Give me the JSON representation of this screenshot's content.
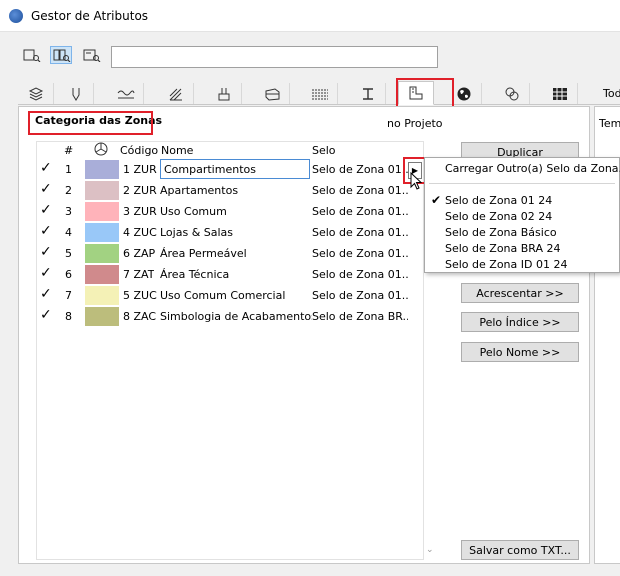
{
  "window": {
    "title": "Gestor de Atributos"
  },
  "toolbar": {
    "search_value": ""
  },
  "tabs": {
    "icons": [
      "layers-icon",
      "pen-icon",
      "line-type-icon",
      "fill-icon",
      "building-material-icon",
      "composite-icon",
      "profile-icon",
      "beam-icon",
      "zone-stamp-icon",
      "globe-icon",
      "mep-icon",
      "table-icon"
    ],
    "partial_label": "Tod"
  },
  "section": {
    "title": "Categoria das Zonas",
    "in_project": "no Projeto"
  },
  "table": {
    "headers": {
      "num": "#",
      "color": "",
      "code": "Código",
      "name": "Nome",
      "stamp": "Selo"
    },
    "rows": [
      {
        "num": "1",
        "color": "#a9aed9",
        "code": "1 ZUR",
        "name": "Compartimentos",
        "stamp": "Selo de Zona 01..."
      },
      {
        "num": "2",
        "color": "#dcc0c4",
        "code": "2 ZUR",
        "name": "Apartamentos",
        "stamp": "Selo de Zona 01..."
      },
      {
        "num": "3",
        "color": "#ffb3ba",
        "code": "3 ZUR",
        "name": "Uso Comum",
        "stamp": "Selo de Zona 01..."
      },
      {
        "num": "4",
        "color": "#99c8f8",
        "code": "4 ZUC",
        "name": "Lojas & Salas",
        "stamp": "Selo de Zona 01..."
      },
      {
        "num": "5",
        "color": "#a2d282",
        "code": "6 ZAP",
        "name": "Área Permeável",
        "stamp": "Selo de Zona 01..."
      },
      {
        "num": "6",
        "color": "#d08a8c",
        "code": "7 ZAT",
        "name": "Área Técnica",
        "stamp": "Selo de Zona 01..."
      },
      {
        "num": "7",
        "color": "#f4f1b6",
        "code": "5 ZUC",
        "name": "Uso Comum Comercial",
        "stamp": "Selo de Zona 01..."
      },
      {
        "num": "8",
        "color": "#bcbd7c",
        "code": "8 ZAC",
        "name": "Simbologia de Acabamentos",
        "stamp": "Selo de Zona BR..."
      }
    ]
  },
  "buttons": {
    "duplicate": "Duplicar",
    "append": "Acrescentar >>",
    "by_index": "Pelo Índice >>",
    "by_name": "Pelo Nome >>",
    "save_txt": "Salvar como TXT..."
  },
  "menu": {
    "load_other": "Carregar Outro(a) Selo da Zona...",
    "items": [
      "Selo de Zona 01 24",
      "Selo de Zona 02 24",
      "Selo de Zona Básico",
      "Selo de Zona BRA 24",
      "Selo de Zona ID 01 24"
    ],
    "checked_index": 0
  },
  "right_panel": {
    "partial_label": "Tem"
  },
  "colors": {
    "highlight": "#e0202a",
    "selection": "#cde4f7"
  }
}
